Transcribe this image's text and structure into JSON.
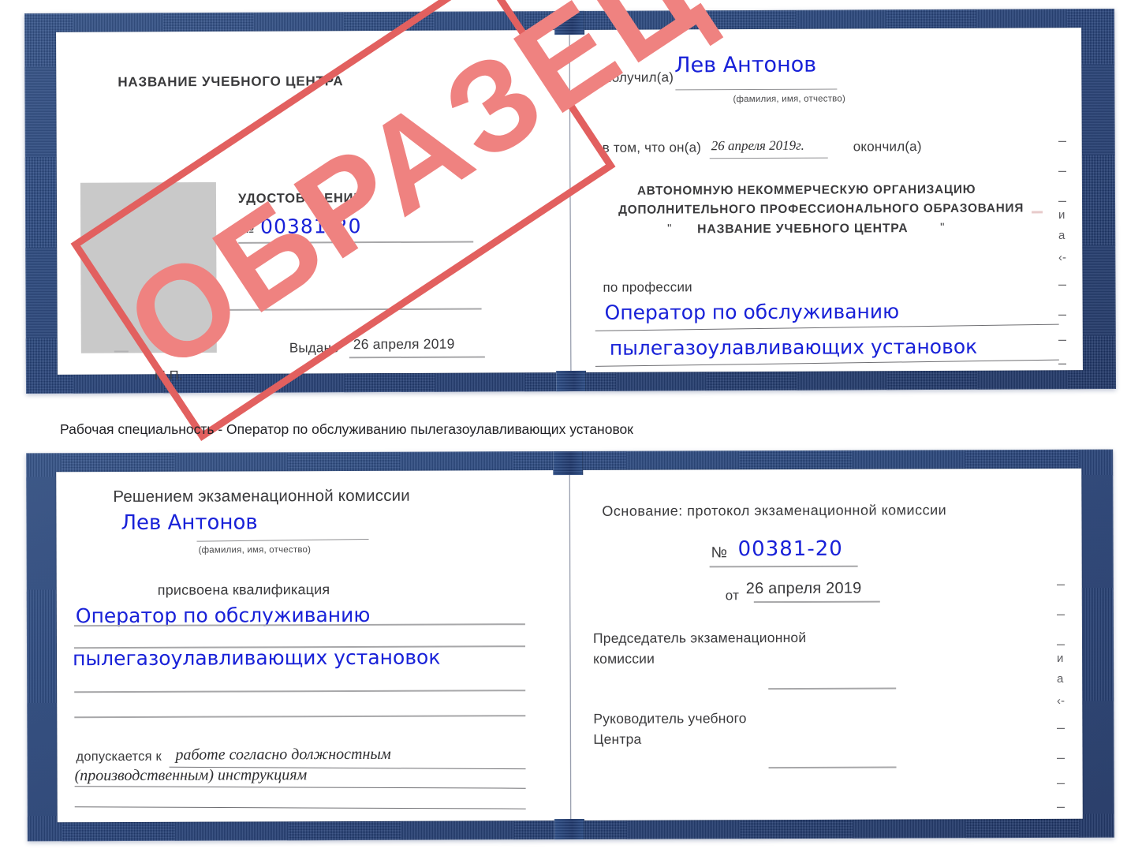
{
  "caption": "Рабочая специальность - Оператор по обслуживанию пылегазоулавливающих установок",
  "colors": {
    "cover_blue": "#2a4a84",
    "stamp_red": "#e2605f",
    "stamp_fill": "#ef8280",
    "handwriting_blue": "#1821d8",
    "photo_gray": "#c9c9c9",
    "rule_gray": "#a7a7a9",
    "page_white": "#ffffff"
  },
  "watermark": {
    "label": "ОБРАЗЕЦ"
  },
  "certificate_top": {
    "left_page": {
      "header": "НАЗВАНИЕ УЧЕБНОГО ЦЕНТРА",
      "doc_title": "УДОСТОВЕРЕНИЕ",
      "number_label": "№",
      "number_value": "00381-20",
      "issued_label": "Выдано",
      "issued_value": "26 апреля 2019",
      "seal_label": "М.П.",
      "photo_placeholder": "photo-placeholder"
    },
    "right_page": {
      "received_label": "Получил(а)",
      "received_value": "Лев Антонов",
      "fio_hint": "(фамилия, имя, отчество)",
      "that_he_label": "в том, что он(а)",
      "that_he_value": "26 апреля 2019г.",
      "finished_label": "окончил(а)",
      "org_line1": "АВТОНОМНУЮ НЕКОММЕРЧЕСКУЮ ОРГАНИЗАЦИЮ",
      "org_line2": "ДОПОЛНИТЕЛЬНОГО ПРОФЕССИОНАЛЬНОГО ОБРАЗОВАНИЯ",
      "org_quote_open": "\"",
      "org_line3": "НАЗВАНИЕ УЧЕБНОГО ЦЕНТРА",
      "org_quote_close": "\"",
      "profession_label": "по профессии",
      "profession_line1": "Оператор по обслуживанию",
      "profession_line2": "пылегазоулавливающих установок",
      "edge_fragments": [
        "–",
        "–",
        "–",
        "и",
        "а",
        "‹-",
        "–",
        "–",
        "–",
        "–"
      ]
    }
  },
  "certificate_bottom": {
    "left_page": {
      "heading": "Решением экзаменационной комиссии",
      "name_value": "Лев Антонов",
      "fio_hint": "(фамилия, имя, отчество)",
      "qualification_label": "присвоена квалификация",
      "qualification_line1": "Оператор по обслуживанию",
      "qualification_line2": "пылегазоулавливающих установок",
      "admitted_label": "допускается к",
      "admitted_line1": "работе согласно должностным",
      "admitted_line2": "(производственным) инструкциям"
    },
    "right_page": {
      "basis_label": "Основание: протокол экзаменационной комиссии",
      "number_label": "№",
      "number_value": "00381-20",
      "date_label": "от",
      "date_value": "26 апреля 2019",
      "chairman_line1": "Председатель экзаменационной",
      "chairman_line2": "комиссии",
      "head_line1": "Руководитель учебного",
      "head_line2": "Центра",
      "edge_fragments": [
        "–",
        "–",
        "–",
        "и",
        "а",
        "‹-",
        "–",
        "–",
        "–",
        "–"
      ]
    }
  }
}
